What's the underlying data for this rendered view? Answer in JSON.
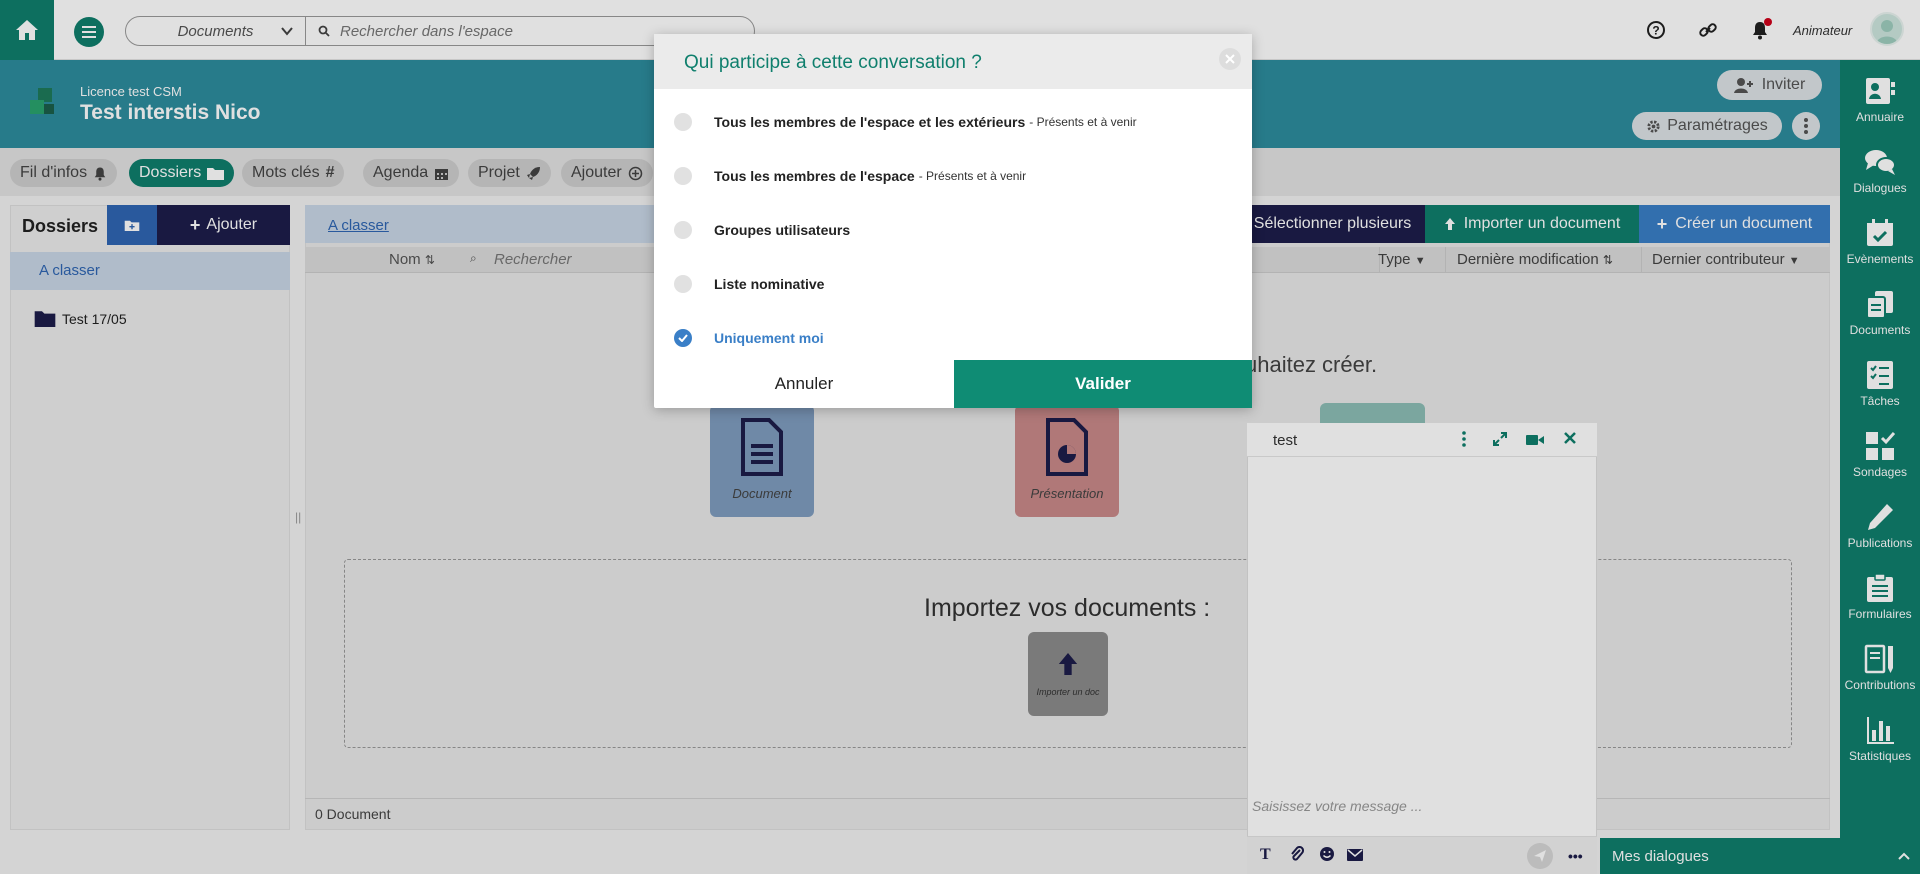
{
  "topbar": {
    "scope": "Documents",
    "search_placeholder": "Rechercher dans l'espace",
    "user_role": "Animateur"
  },
  "space": {
    "license": "Licence test CSM",
    "name": "Test interstis Nico",
    "invite_label": "Inviter",
    "settings_label": "Paramétrages"
  },
  "tabs": [
    {
      "label": "Fil d'infos",
      "icon": "bell-icon"
    },
    {
      "label": "Dossiers",
      "icon": "folder-icon",
      "active": true
    },
    {
      "label": "Mots clés",
      "icon": "hashtag-icon"
    },
    {
      "label": "Agenda",
      "icon": "calendar-icon"
    },
    {
      "label": "Projet",
      "icon": "rocket-icon"
    },
    {
      "label": "Ajouter",
      "icon": "plus-circle-icon"
    }
  ],
  "left_panel": {
    "title": "Dossiers",
    "add_label": "Ajouter",
    "unfiled_label": "A classer",
    "folders": [
      "Test 17/05"
    ]
  },
  "main": {
    "breadcrumb": "A classer",
    "select_multiple": "Sélectionner plusieurs",
    "import_doc": "Importer un document",
    "create_doc": "Créer un document",
    "columns": {
      "name": "Nom",
      "search_placeholder": "Rechercher",
      "type": "Type",
      "last_modified": "Dernière modification",
      "last_contributor": "Dernier contributeur"
    },
    "create_prompt": "uhaitez créer.",
    "tiles": [
      "Document",
      "Présentation"
    ],
    "import_title": "Importez vos documents :",
    "import_tile": "Importer un doc",
    "count": "0 Document"
  },
  "sidebar": [
    {
      "label": "Annuaire",
      "icon": "contact-card-icon"
    },
    {
      "label": "Dialogues",
      "icon": "chat-bubbles-icon"
    },
    {
      "label": "Evènements",
      "icon": "calendar-check-icon"
    },
    {
      "label": "Documents",
      "icon": "documents-icon"
    },
    {
      "label": "Tâches",
      "icon": "task-list-icon"
    },
    {
      "label": "Sondages",
      "icon": "grid-check-icon"
    },
    {
      "label": "Publications",
      "icon": "pencil-icon"
    },
    {
      "label": "Formulaires",
      "icon": "clipboard-icon"
    },
    {
      "label": "Contributions",
      "icon": "contributions-icon"
    },
    {
      "label": "Statistiques",
      "icon": "bar-chart-icon"
    }
  ],
  "chat": {
    "title": "test",
    "input_placeholder": "Saisissez votre message ...",
    "my_dialogues": "Mes dialogues"
  },
  "modal": {
    "title": "Qui participe à cette conversation ?",
    "options": [
      {
        "label": "Tous les membres de l'espace et les extérieurs",
        "hint": "- Présents et à venir",
        "selected": false
      },
      {
        "label": "Tous les membres de l'espace",
        "hint": "- Présents et à venir",
        "selected": false
      },
      {
        "label": "Groupes utilisateurs",
        "hint": "",
        "selected": false
      },
      {
        "label": "Liste nominative",
        "hint": "",
        "selected": false
      },
      {
        "label": "Uniquement moi",
        "hint": "",
        "selected": true
      }
    ],
    "cancel_label": "Annuler",
    "confirm_label": "Valider"
  },
  "colors": {
    "brand_green": "#0f7f6d",
    "header_teal": "#2d8d9e",
    "accent_blue": "#3a7fc7",
    "navy": "#1d1d4a"
  }
}
